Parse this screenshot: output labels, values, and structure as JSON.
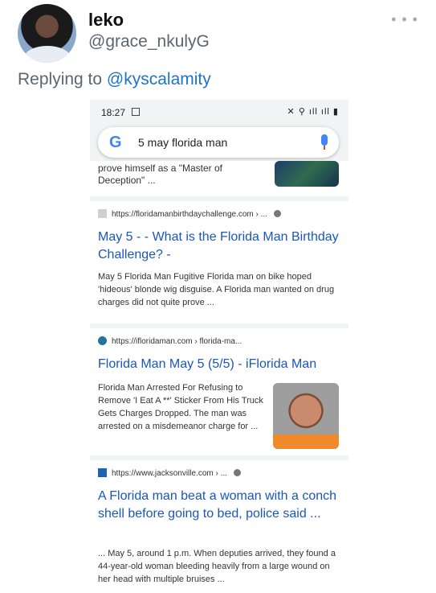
{
  "tweet": {
    "name": "leko",
    "handle": "@grace_nkulyG",
    "more": "• • •",
    "reply_prefix": "Replying to",
    "reply_to": "@kyscalamity"
  },
  "phone": {
    "status_time": "18:27",
    "status_icons": "✕ ⚲ ıll ıll ▮",
    "search_query": "5 may florida man",
    "search_logo": "G",
    "partial_result": "prove himself as a \"Master of Deception\" ...",
    "results": [
      {
        "url": "https://floridamanbirthdaychallenge.com › ...",
        "title": "May 5 - - What is the Florida Man Birthday Challenge? -",
        "snippet": "May 5 Florida Man Fugitive Florida man on bike hoped 'hideous' blonde wig disguise. A Florida man wanted on drug charges did not quite prove ..."
      },
      {
        "url": "https://ifloridaman.com › florida-ma...",
        "title": "Florida Man May 5 (5/5) - iFlorida Man",
        "snippet": "Florida Man Arrested For Refusing to Remove 'I Eat A **' Sticker From His Truck Gets Charges Dropped. The man was arrested on a misdemeanor charge for ..."
      },
      {
        "url": "https://www.jacksonville.com › ...",
        "title": "A Florida man beat a woman with a conch shell before going to bed, police said ...",
        "snippet": "... May 5, around 1 p.m. When deputies arrived, they found a 44-year-old woman bleeding heavily from a large wound on her head with multiple bruises ..."
      }
    ]
  },
  "colors": {
    "link": "#1a57b8",
    "muted": "#5b6670",
    "mention": "#1d74c7"
  }
}
